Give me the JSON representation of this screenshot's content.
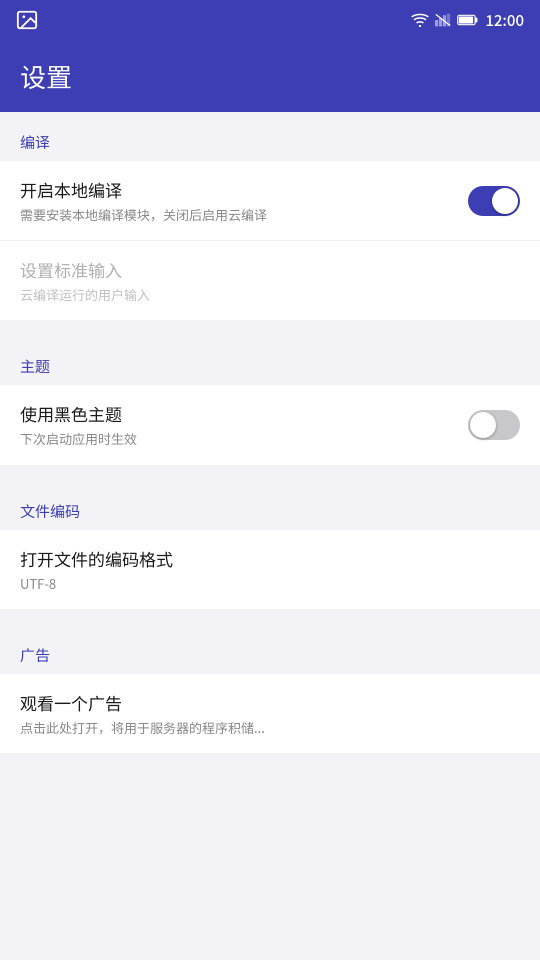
{
  "statusBar": {
    "time": "12:00"
  },
  "header": {
    "title": "设置"
  },
  "sections": [
    {
      "id": "translation",
      "label": "编译",
      "items": [
        {
          "id": "local-translation",
          "title": "开启本地编译",
          "subtitle": "需要安装本地编译模块，关闭后启用云编译",
          "type": "toggle",
          "value": true,
          "disabled": false
        },
        {
          "id": "standard-input",
          "title": "设置标准输入",
          "subtitle": "云编译运行的用户输入",
          "type": "text",
          "value": "",
          "disabled": true
        }
      ]
    },
    {
      "id": "theme",
      "label": "主题",
      "items": [
        {
          "id": "dark-theme",
          "title": "使用黑色主题",
          "subtitle": "下次启动应用时生效",
          "type": "toggle",
          "value": false,
          "disabled": false
        }
      ]
    },
    {
      "id": "file-encoding",
      "label": "文件编码",
      "items": [
        {
          "id": "encoding-format",
          "title": "打开文件的编码格式",
          "subtitle": "UTF-8",
          "type": "value",
          "value": "UTF-8",
          "disabled": false
        }
      ]
    },
    {
      "id": "ads",
      "label": "广告",
      "items": [
        {
          "id": "watch-ad",
          "title": "观看一个广告",
          "subtitle": "点击此处打开，将用于服务器的程序积储...",
          "type": "text",
          "value": "",
          "disabled": false
        }
      ]
    }
  ]
}
